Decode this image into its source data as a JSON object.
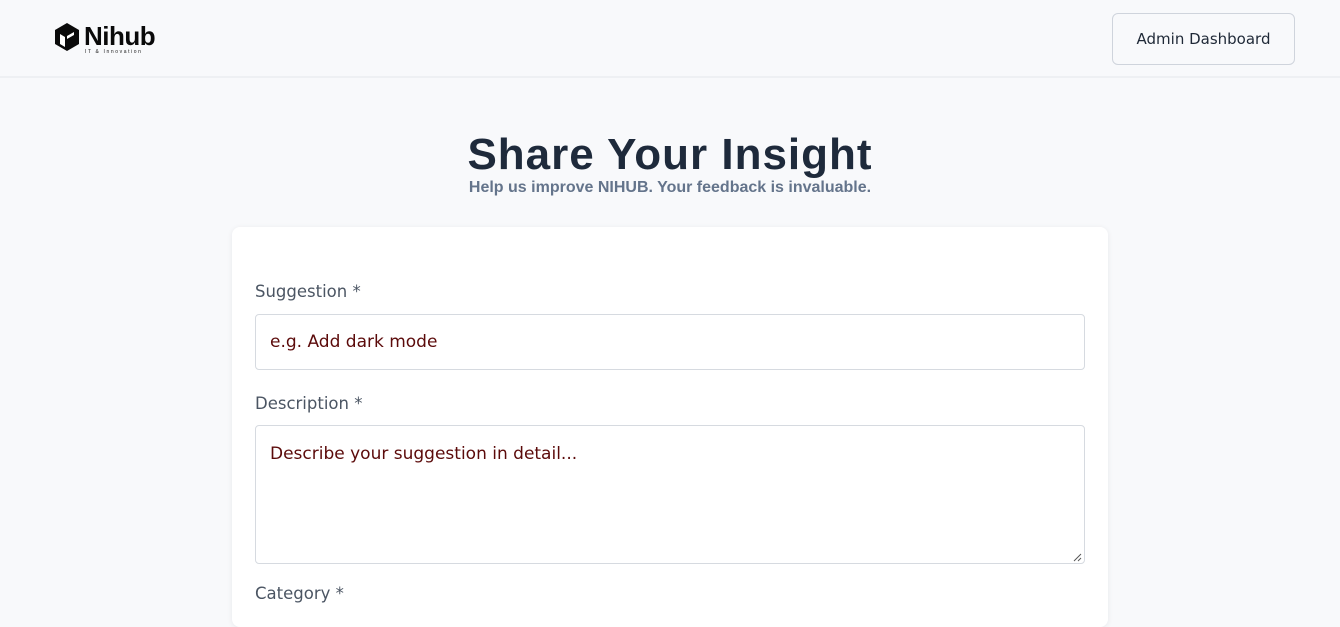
{
  "header": {
    "logo": {
      "word": "Nihub",
      "tagline": "IT & Innovation",
      "icon": "hexagon-logo-icon"
    },
    "admin_button_label": "Admin Dashboard"
  },
  "hero": {
    "title": "Share Your Insight",
    "subtitle": "Help us improve NIHUB. Your feedback is invaluable."
  },
  "form": {
    "suggestion": {
      "label": "Suggestion *",
      "placeholder": "e.g. Add dark mode",
      "value": ""
    },
    "description": {
      "label": "Description *",
      "placeholder": "Describe your suggestion in detail...",
      "value": ""
    },
    "category": {
      "label": "Category *"
    }
  },
  "colors": {
    "page_background": "#f8f9fb",
    "title_color": "#1e2a3b",
    "subtitle_color": "#64748b",
    "placeholder_color": "#5b0a0a",
    "input_border": "#d6dae0"
  }
}
